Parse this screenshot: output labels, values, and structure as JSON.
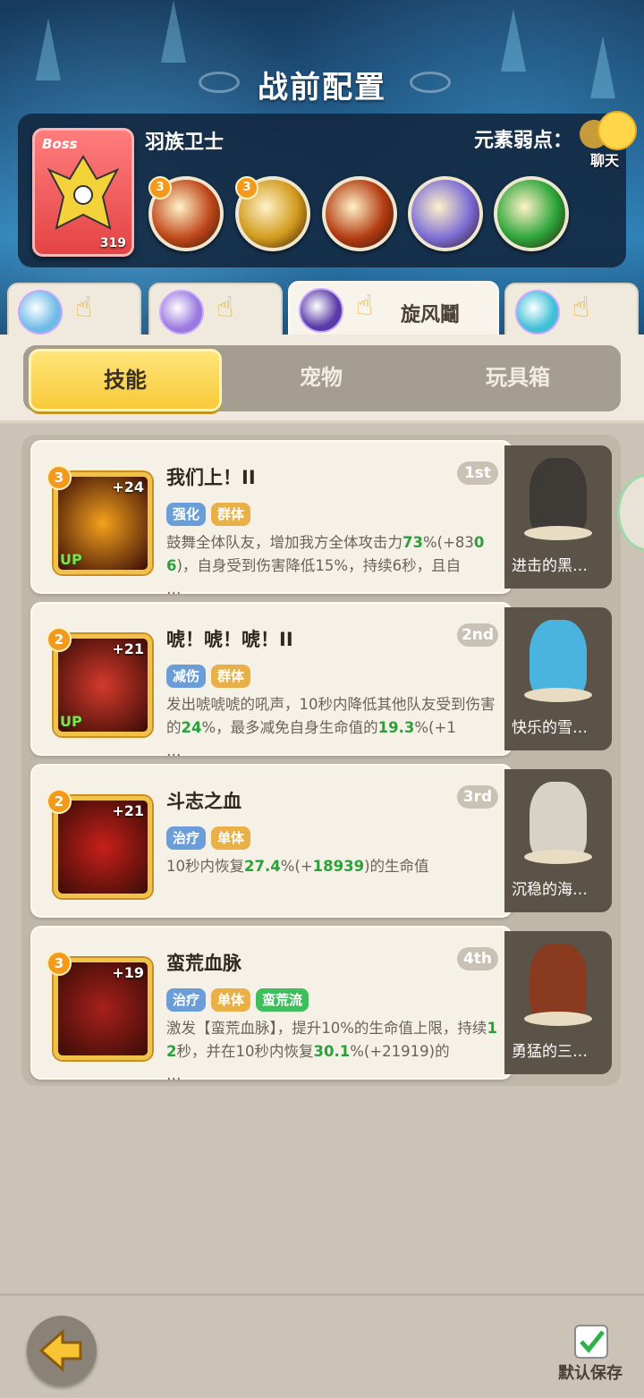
{
  "title": "战前配置",
  "boss": {
    "tag": "Boss",
    "name": "羽族卫士",
    "level": "319",
    "weakness_label": "元素弱点：",
    "skills": [
      {
        "badge": "3",
        "color": "#c0481a"
      },
      {
        "badge": "3",
        "color": "#d19a1c"
      },
      {
        "badge": "",
        "color": "#b33b12"
      },
      {
        "badge": "",
        "color": "#7d6ed6"
      },
      {
        "badge": "",
        "color": "#2da53a"
      }
    ]
  },
  "chat": {
    "label": "聊天"
  },
  "hero_tabs": [
    {
      "label": "",
      "avatar_color": "#6fbbe8",
      "active": false
    },
    {
      "label": "",
      "avatar_color": "#9a7ae0",
      "active": false
    },
    {
      "label": "旋风鬮",
      "avatar_color": "#5a3aa8",
      "active": true
    },
    {
      "label": "",
      "avatar_color": "#3fc0d6",
      "active": false
    }
  ],
  "segments": {
    "skill": "技能",
    "pet": "宠物",
    "toybox": "玩具箱"
  },
  "skills": [
    {
      "level": "3",
      "plus": "+24",
      "up": "UP",
      "name": "我们上！II",
      "rank": "1st",
      "tags": [
        {
          "text": "强化",
          "kind": "blue"
        },
        {
          "text": "群体",
          "kind": "gold"
        }
      ],
      "desc_a": "鼓舞全体队友，增加我方全体攻击力",
      "desc_b": "73",
      "desc_c": "%(+83",
      "desc_d": "06",
      "desc_e": ")，自身受到伤害降低15%，持续6秒，且自",
      "desc_f": "…",
      "icon_color": "#f4a21c",
      "pet_name": "进击的黑…",
      "pet_color": "#3e3a36"
    },
    {
      "level": "2",
      "plus": "+21",
      "up": "UP",
      "name": "唬！唬！唬！II",
      "rank": "2nd",
      "tags": [
        {
          "text": "减伤",
          "kind": "blue"
        },
        {
          "text": "群体",
          "kind": "gold"
        }
      ],
      "desc_a": "发出唬唬唬的吼声，10秒内降低其他队友受到伤害的",
      "desc_b": "24",
      "desc_c": "%，最多减免自身生命值的",
      "desc_d": "19.3",
      "desc_e": "%(+1",
      "desc_f": "…",
      "icon_color": "#d43a2c",
      "pet_name": "快乐的雪…",
      "pet_color": "#4bb3e0"
    },
    {
      "level": "2",
      "plus": "+21",
      "up": "",
      "name": "斗志之血",
      "rank": "3rd",
      "tags": [
        {
          "text": "治疗",
          "kind": "blue"
        },
        {
          "text": "单体",
          "kind": "gold"
        }
      ],
      "desc_a": "10秒内恢复",
      "desc_b": "27.4",
      "desc_c": "%(+",
      "desc_d": "18939",
      "desc_e": ")的生命值",
      "desc_f": "",
      "icon_color": "#c8201a",
      "pet_name": "沉稳的海…",
      "pet_color": "#d8d2c6"
    },
    {
      "level": "3",
      "plus": "+19",
      "up": "",
      "name": "蛮荒血脉",
      "rank": "4th",
      "tags": [
        {
          "text": "治疗",
          "kind": "blue"
        },
        {
          "text": "单体",
          "kind": "gold"
        },
        {
          "text": "蛮荒流",
          "kind": "green"
        }
      ],
      "desc_a": "激发【蛮荒血脉】，提升10%的生命值上限，持续",
      "desc_b": "12",
      "desc_c": "秒，并在10秒内恢复",
      "desc_d": "30.1",
      "desc_e": "%(+21919)的",
      "desc_f": "…",
      "icon_color": "#a8201c",
      "pet_name": "勇猛的三…",
      "pet_color": "#8a3a1e"
    }
  ],
  "footer": {
    "save_label": "默认保存"
  }
}
